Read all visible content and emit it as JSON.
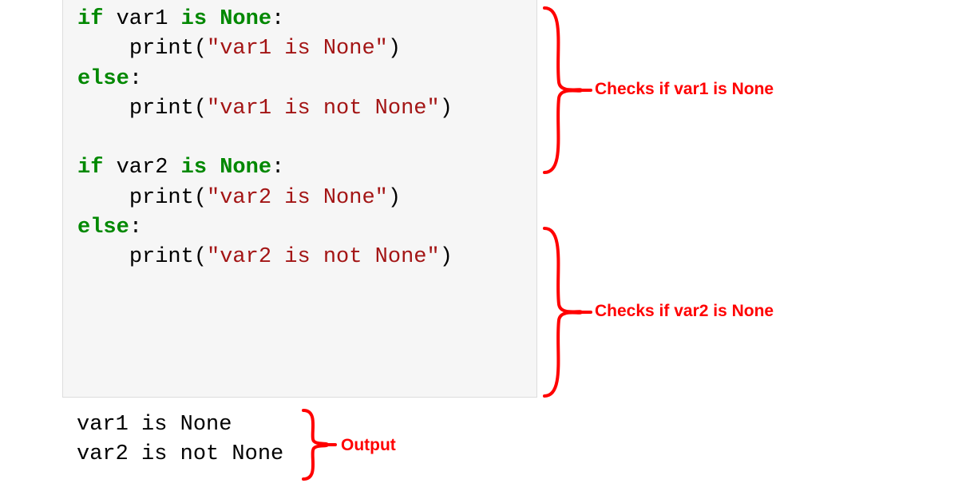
{
  "code": {
    "block1": {
      "line1": {
        "kw_if": "if",
        "var": "var1",
        "kw_is": "is",
        "kw_none": "None",
        "colon": ":"
      },
      "line2": {
        "fn": "print",
        "open": "(",
        "str": "\"var1 is None\"",
        "close": ")"
      },
      "line3": {
        "kw_else": "else",
        "colon": ":"
      },
      "line4": {
        "fn": "print",
        "open": "(",
        "str": "\"var1 is not None\"",
        "close": ")"
      }
    },
    "block2": {
      "line1": {
        "kw_if": "if",
        "var": "var2",
        "kw_is": "is",
        "kw_none": "None",
        "colon": ":"
      },
      "line2": {
        "fn": "print",
        "open": "(",
        "str": "\"var2 is None\"",
        "close": ")"
      },
      "line3": {
        "kw_else": "else",
        "colon": ":"
      },
      "line4": {
        "fn": "print",
        "open": "(",
        "str": "\"var2 is not None\"",
        "close": ")"
      }
    }
  },
  "output": {
    "line1": "var1 is None",
    "line2": "var2 is not None"
  },
  "annotations": {
    "a1": "Checks if var1 is None",
    "a2": "Checks if var2 is None",
    "a3": "Output"
  }
}
